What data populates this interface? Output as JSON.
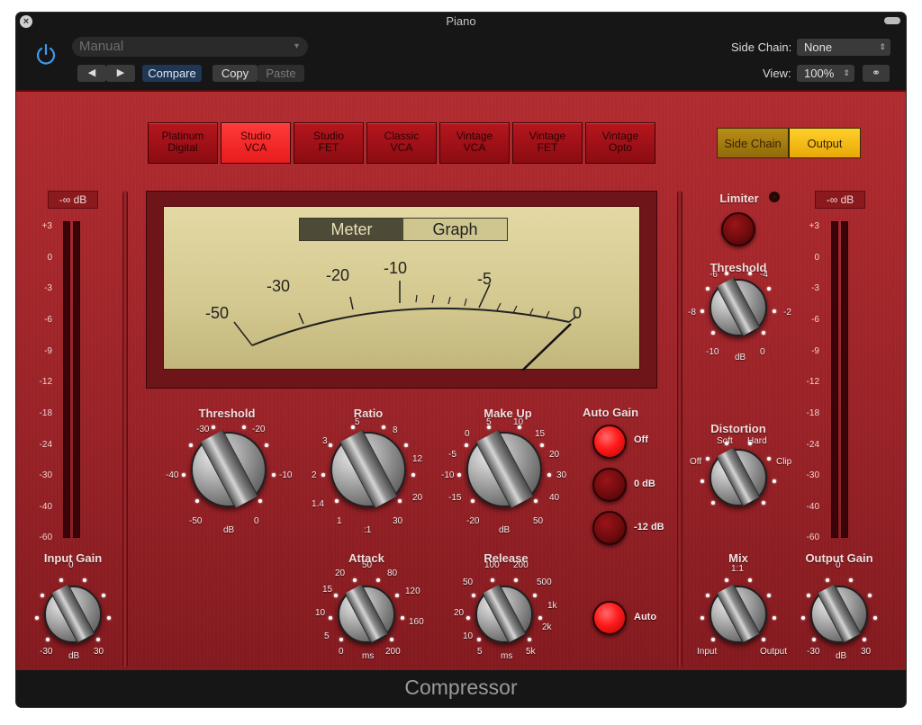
{
  "window": {
    "title": "Piano",
    "close_glyph": "×"
  },
  "header": {
    "preset": "Manual",
    "prev": "◀",
    "next": "▶",
    "compare": "Compare",
    "copy": "Copy",
    "paste": "Paste",
    "side_chain_label": "Side Chain:",
    "side_chain_value": "None",
    "view_label": "View:",
    "view_value": "100%",
    "updown": "⇕"
  },
  "models": [
    {
      "label": "Platinum\nDigital",
      "active": false
    },
    {
      "label": "Studio\nVCA",
      "active": true
    },
    {
      "label": "Studio\nFET",
      "active": false
    },
    {
      "label": "Classic\nVCA",
      "active": false
    },
    {
      "label": "Vintage\nVCA",
      "active": false
    },
    {
      "label": "Vintage\nFET",
      "active": false
    },
    {
      "label": "Vintage\nOpto",
      "active": false
    }
  ],
  "view_buttons": {
    "side_chain": "Side Chain",
    "output": "Output"
  },
  "input_meter": {
    "readout": "-∞ dB"
  },
  "output_meter": {
    "readout": "-∞ dB"
  },
  "meter_scale": [
    "+3",
    "0",
    "-3",
    "-6",
    "-9",
    "-12",
    "-18",
    "-24",
    "-30",
    "-40",
    "-60"
  ],
  "vu": {
    "tabs": [
      "Meter",
      "Graph"
    ],
    "active_tab": "Meter",
    "scale": [
      "-50",
      "-30",
      "-20",
      "-10",
      "-5",
      "0"
    ],
    "needle_value": "0"
  },
  "knobs": {
    "threshold": {
      "label": "Threshold",
      "ticks": [
        "-30",
        "-20",
        "-40",
        "-10",
        "-50",
        "dB",
        "0"
      ]
    },
    "ratio": {
      "label": "Ratio",
      "ticks": [
        "5",
        "3",
        "8",
        "2",
        "12",
        "1.4",
        "20",
        "1",
        ":1",
        "30"
      ]
    },
    "makeup": {
      "label": "Make Up",
      "ticks": [
        "5",
        "10",
        "0",
        "15",
        "-5",
        "20",
        "-10",
        "30",
        "-15",
        "40",
        "-20",
        "dB",
        "50"
      ]
    },
    "attack": {
      "label": "Attack",
      "ticks": [
        "50",
        "20",
        "80",
        "15",
        "120",
        "10",
        "160",
        "5",
        "0",
        "ms",
        "200"
      ]
    },
    "release": {
      "label": "Release",
      "ticks": [
        "100",
        "200",
        "50",
        "500",
        "20",
        "1k",
        "10",
        "2k",
        "5",
        "ms",
        "5k"
      ]
    },
    "input_gain": {
      "label": "Input Gain",
      "ticks": [
        "0",
        "-30",
        "dB",
        "30"
      ]
    },
    "limiter_threshold": {
      "label": "Threshold",
      "ticks": [
        "-6",
        "-4",
        "-8",
        "-2",
        "-10",
        "dB",
        "0"
      ]
    },
    "distortion": {
      "label": "Distortion",
      "ticks": [
        "Soft",
        "Hard",
        "Off",
        "Clip"
      ]
    },
    "mix": {
      "label": "Mix",
      "ticks": [
        "1:1",
        "Input",
        "Output"
      ]
    },
    "output_gain": {
      "label": "Output Gain",
      "ticks": [
        "0",
        "-30",
        "dB",
        "30"
      ]
    }
  },
  "auto_gain": {
    "label": "Auto Gain",
    "off": "Off",
    "zero": "0 dB",
    "minus12": "-12 dB",
    "auto": "Auto"
  },
  "limiter": {
    "label": "Limiter"
  },
  "footer": {
    "title": "Compressor"
  }
}
